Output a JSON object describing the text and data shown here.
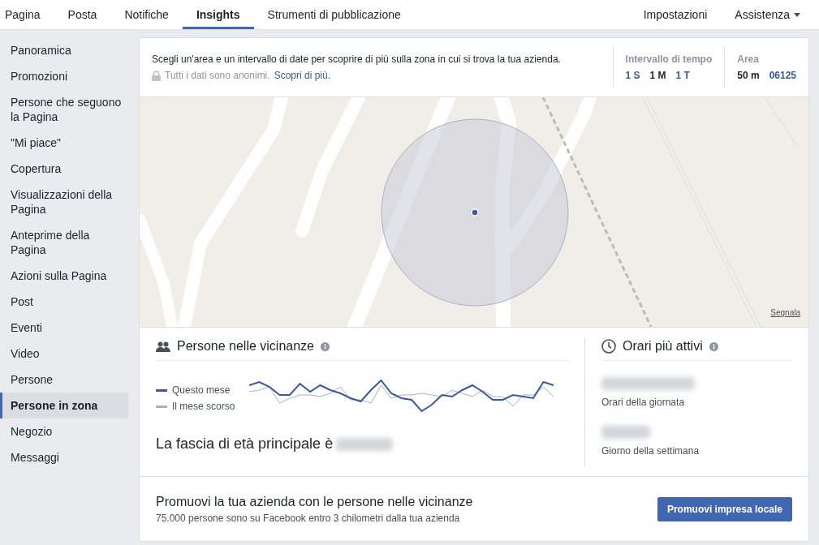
{
  "top_nav": {
    "tabs": [
      {
        "label": "Pagina",
        "selected": false
      },
      {
        "label": "Posta",
        "selected": false
      },
      {
        "label": "Notifiche",
        "selected": false
      },
      {
        "label": "Insights",
        "selected": true
      },
      {
        "label": "Strumenti di pubblicazione",
        "selected": false
      }
    ],
    "right": [
      {
        "label": "Impostazioni",
        "kind": "link"
      },
      {
        "label": "Assistenza",
        "kind": "menu"
      }
    ]
  },
  "sidebar": {
    "items": [
      {
        "label": "Panoramica",
        "selected": false
      },
      {
        "label": "Promozioni",
        "selected": false
      },
      {
        "label": "Persone che seguono la Pagina",
        "selected": false
      },
      {
        "label": "\"Mi piace\"",
        "selected": false
      },
      {
        "label": "Copertura",
        "selected": false
      },
      {
        "label": "Visualizzazioni della Pagina",
        "selected": false
      },
      {
        "label": "Anteprime della Pagina",
        "selected": false
      },
      {
        "label": "Azioni sulla Pagina",
        "selected": false
      },
      {
        "label": "Post",
        "selected": false
      },
      {
        "label": "Eventi",
        "selected": false
      },
      {
        "label": "Video",
        "selected": false
      },
      {
        "label": "Persone",
        "selected": false
      },
      {
        "label": "Persone in zona",
        "selected": true
      },
      {
        "label": "Negozio",
        "selected": false
      },
      {
        "label": "Messaggi",
        "selected": false
      }
    ]
  },
  "header": {
    "description": "Scegli un'area e un intervallo di date per scoprire di più sulla zona in cui si trova la tua azienda.",
    "privacy_note": "Tutti i dati sono anonimi.",
    "privacy_link": "Scopri di più.",
    "time_range": {
      "label": "Intervallo di tempo",
      "options": [
        {
          "label": "1 S",
          "selected": false
        },
        {
          "label": "1 M",
          "selected": true
        },
        {
          "label": "1 T",
          "selected": false
        }
      ]
    },
    "area": {
      "label": "Area",
      "options": [
        {
          "label": "50 m",
          "selected": true
        },
        {
          "label": "06125",
          "selected": false
        }
      ]
    }
  },
  "map": {
    "report_link": "Segnala"
  },
  "nearby": {
    "title": "Persone nelle vicinanze",
    "legend": [
      {
        "label": "Questo mese",
        "color": "#3b5998"
      },
      {
        "label": "Il mese scorso",
        "color": "#aab0bd"
      }
    ],
    "age_text": "La fascia di età principale è"
  },
  "active_hours": {
    "title": "Orari più attivi",
    "items": [
      {
        "caption": "Orari della giornata"
      },
      {
        "caption": "Giorno della settimana"
      }
    ]
  },
  "promo": {
    "title": "Promuovi la tua azienda con le persone nelle vicinanze",
    "subtitle": "75.000 persone sono su Facebook entro 3  chilometri dalla tua azienda",
    "button": "Promuovi impresa locale"
  }
}
